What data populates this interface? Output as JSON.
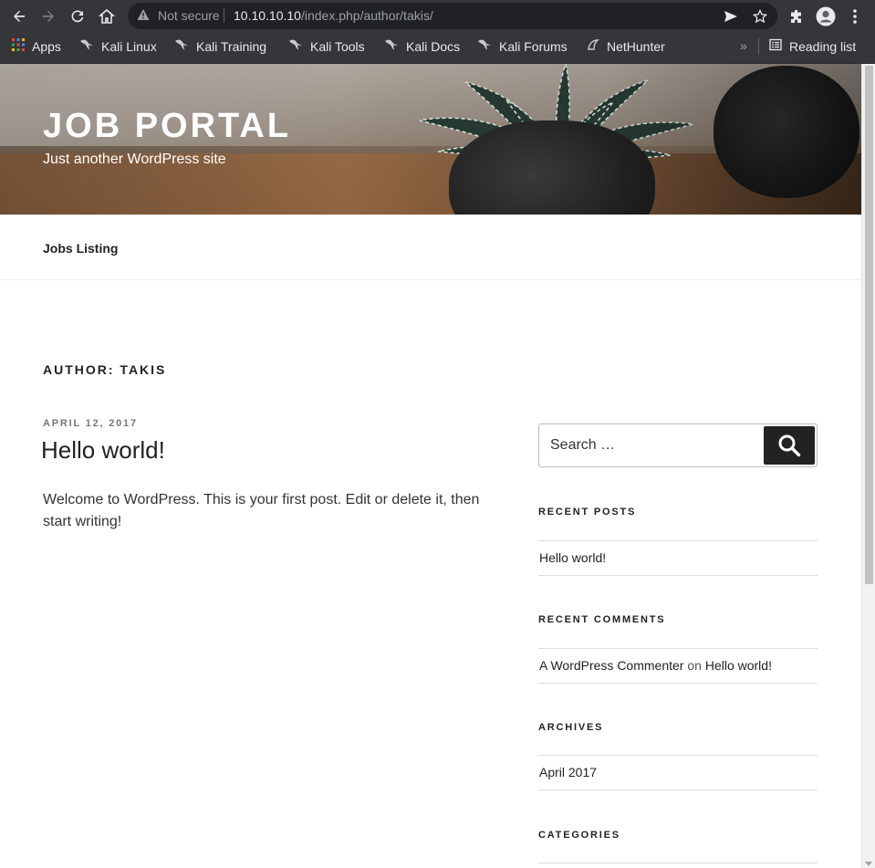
{
  "browser": {
    "omnibox": {
      "security_label": "Not secure",
      "url_host": "10.10.10.10",
      "url_path": "/index.php/author/takis/"
    },
    "bookmarks": [
      {
        "label": "Apps",
        "icon": "apps-grid-icon"
      },
      {
        "label": "Kali Linux",
        "icon": "kali-dragon-icon"
      },
      {
        "label": "Kali Training",
        "icon": "kali-dragon-icon"
      },
      {
        "label": "Kali Tools",
        "icon": "kali-dragon-icon"
      },
      {
        "label": "Kali Docs",
        "icon": "kali-dragon-icon"
      },
      {
        "label": "Kali Forums",
        "icon": "kali-dragon-icon"
      },
      {
        "label": "NetHunter",
        "icon": "nethunter-icon"
      }
    ],
    "overflow_chevron": "»",
    "reading_list_label": "Reading list"
  },
  "site": {
    "title": "JOB PORTAL",
    "description": "Just another WordPress site",
    "nav": [
      "Jobs Listing"
    ]
  },
  "archive": {
    "title": "AUTHOR: TAKIS"
  },
  "posts": [
    {
      "date": "APRIL 12, 2017",
      "title": "Hello world!",
      "excerpt": "Welcome to WordPress. This is your first post. Edit or delete it, then start writing!"
    }
  ],
  "sidebar": {
    "search_placeholder": "Search …",
    "recent_posts": {
      "title": "RECENT POSTS",
      "items": [
        "Hello world!"
      ]
    },
    "recent_comments": {
      "title": "RECENT COMMENTS",
      "items": [
        {
          "author": "A WordPress Commenter",
          "joiner": "on",
          "post": "Hello world!"
        }
      ]
    },
    "archives": {
      "title": "ARCHIVES",
      "items": [
        "April 2017"
      ]
    },
    "categories": {
      "title": "CATEGORIES"
    }
  },
  "colors": {
    "chrome_bg": "#35363a",
    "omnibox_bg": "#202124",
    "text_dark": "#222222",
    "meta_gray": "#767676"
  }
}
